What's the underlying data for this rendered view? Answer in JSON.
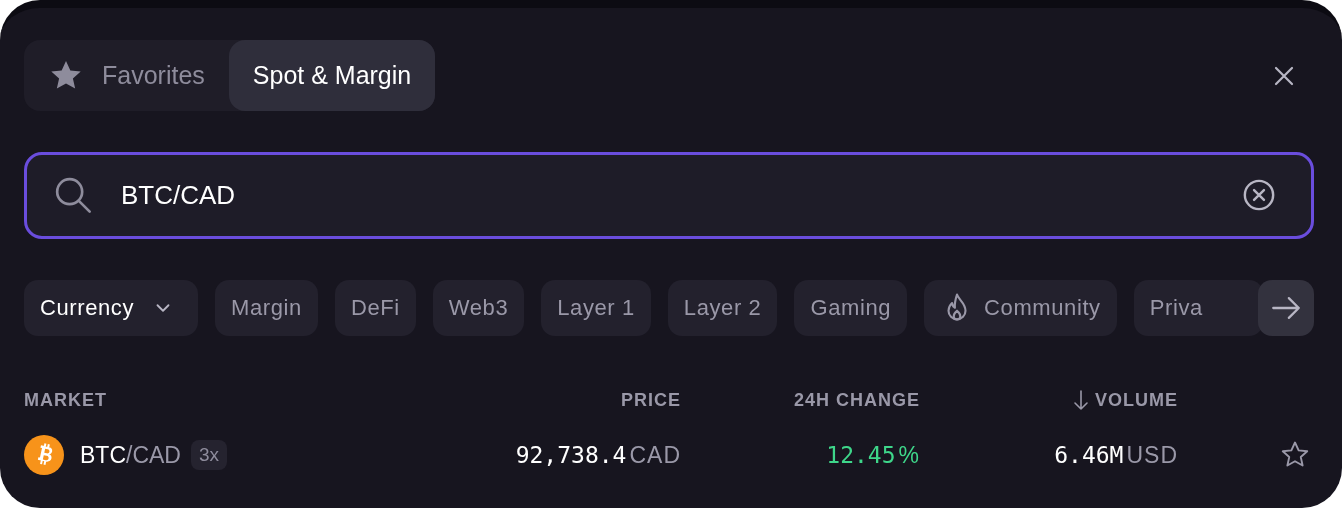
{
  "tabs": [
    {
      "label": "Favorites",
      "kind": "starred",
      "selected": false
    },
    {
      "label": "Spot & Margin",
      "kind": "plain",
      "selected": true
    }
  ],
  "search": {
    "value": "BTC/CAD"
  },
  "filters": [
    {
      "label": "Currency",
      "kind": "dropdown"
    },
    {
      "label": "Margin",
      "kind": "chip"
    },
    {
      "label": "DeFi",
      "kind": "chip"
    },
    {
      "label": "Web3",
      "kind": "chip"
    },
    {
      "label": "Layer 1",
      "kind": "chip"
    },
    {
      "label": "Layer 2",
      "kind": "chip"
    },
    {
      "label": "Gaming",
      "kind": "chip"
    },
    {
      "label": "Community",
      "kind": "flame"
    },
    {
      "label": "Priva",
      "kind": "chip"
    }
  ],
  "table": {
    "columns": [
      {
        "label": "MARKET",
        "sorted": false
      },
      {
        "label": "PRICE",
        "sorted": false
      },
      {
        "label": "24H CHANGE",
        "sorted": false
      },
      {
        "label": "VOLUME",
        "sorted": true
      }
    ],
    "rows": [
      {
        "base": "BTC",
        "quote": "/CAD",
        "leverage": "3x",
        "price": "92,738.4",
        "price_unit": "CAD",
        "change": "12.45",
        "change_unit": "%",
        "rising": true,
        "volume": "6.46M",
        "volume_unit": "USD",
        "favorite": false
      }
    ]
  }
}
